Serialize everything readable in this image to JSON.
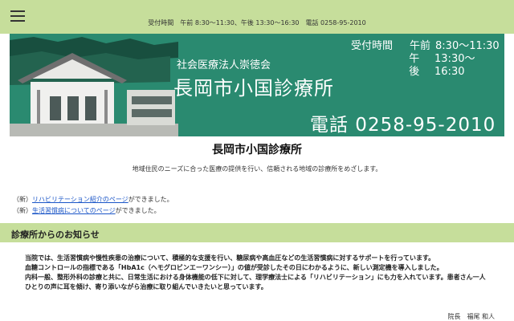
{
  "topbar": {
    "hours_line": "受付時間　午前 8:30～11:30、午後 13:30～16:30　電話 0258-95-2010"
  },
  "banner": {
    "corp": "社会医療法人崇徳会",
    "name": "長岡市小国診療所",
    "hours_label": "受付時間",
    "am_label": "午前",
    "am_time": "8:30～11:30",
    "pm_label": "午後",
    "pm_time": "13:30～16:30",
    "phone": "電話 0258-95-2010"
  },
  "main": {
    "title": "長岡市小国診療所",
    "subtitle": "地域住民のニーズに合った医療の提供を行い、信頼される地域の診療所をめざします。"
  },
  "news": [
    {
      "prefix": "（新）",
      "link": "リハビリテーション紹介のページ",
      "suffix": "ができました。"
    },
    {
      "prefix": "（新）",
      "link": "生活習慣病についてのページ",
      "suffix": "ができました。"
    }
  ],
  "section": {
    "heading": "診療所からのお知らせ"
  },
  "notice": {
    "p1": "当院では、生活習慣病や慢性疾患の治療について、積極的な支援を行い、糖尿病や高血圧などの生活習慣病に対するサポートを行っています。",
    "p2": "血糖コントロールの指標である「HbA1c（ヘモグロビンエーワンシー）」の値が受診したその日にわかるように、新しい測定機を導入しました。",
    "p3": "内科一般、整形外科の診療と共に、日常生活における身体機能の低下に対して、理学療法士による「リハビリテーション」にも力を入れています。患者さん一人ひとりの声に耳を傾け、寄り添いながら治療に取り組んでいきたいと思っています。",
    "signature": "院長　福尾 和人"
  },
  "icons": {
    "menu": "hamburger-menu-icon"
  },
  "colors": {
    "header_green": "#c6de9b",
    "banner_teal": "#2a8a70",
    "link_blue": "#1a55c7"
  }
}
